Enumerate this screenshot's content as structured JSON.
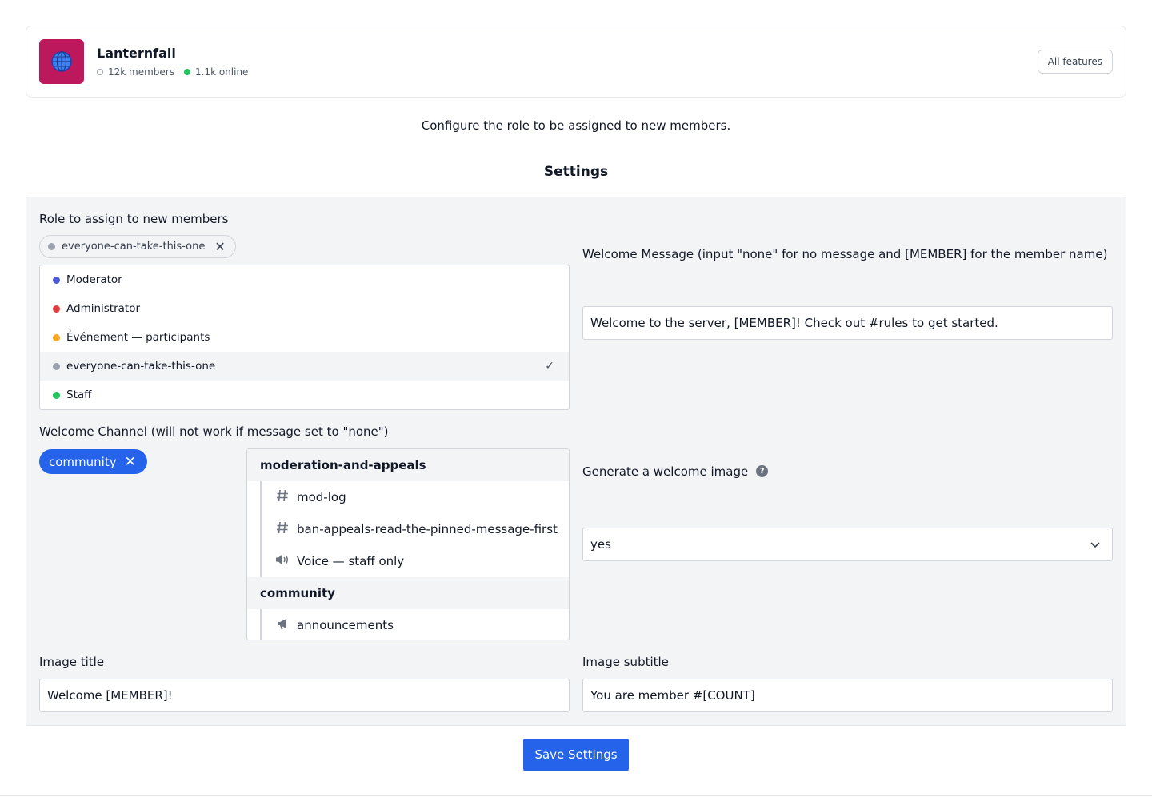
{
  "server": {
    "name": "Lanternfall",
    "members": "12k members",
    "online": "1.1k online",
    "icon": "globe-icon",
    "icon_color": "#be185d",
    "all_features_label": "All features"
  },
  "description": "Configure the role to be assigned to new members.",
  "settings_heading": "Settings",
  "role": {
    "label": "Role to assign to new members",
    "selected": {
      "name": "everyone-can-take-this-one",
      "color": "#9ca3af"
    },
    "options": [
      {
        "name": "Moderator",
        "color": "#4f5bd5",
        "selected": false
      },
      {
        "name": "Administrator",
        "color": "#e03e3e",
        "selected": false
      },
      {
        "name": "Événement — participants",
        "color": "#f5a623",
        "selected": false
      },
      {
        "name": "everyone-can-take-this-one",
        "color": "#9ca3af",
        "selected": true
      },
      {
        "name": "Staff",
        "color": "#22c55e",
        "selected": false
      }
    ],
    "check_glyph": "✓"
  },
  "welcome_message": {
    "label": "Welcome Message (input \"none\" for no message and [MEMBER] for the member name)",
    "value": "Welcome to the server, [MEMBER]! Check out #rules to get started."
  },
  "welcome_channel": {
    "label": "Welcome Channel (will not work if message set to \"none\")",
    "selected": "community",
    "categories": [
      {
        "name": "moderation-and-appeals",
        "channels": [
          {
            "name": "mod-log",
            "type": "text",
            "icon": "hash-icon"
          },
          {
            "name": "ban-appeals-read-the-pinned-message-first",
            "type": "text",
            "icon": "hash-icon"
          },
          {
            "name": "Voice — staff only",
            "type": "voice",
            "icon": "speaker-icon"
          }
        ]
      },
      {
        "name": "community",
        "channels": [
          {
            "name": "announcements",
            "type": "announcement",
            "icon": "megaphone-icon"
          }
        ]
      }
    ]
  },
  "welcome_image": {
    "label": "Generate a welcome image",
    "value": "yes"
  },
  "image_title": {
    "label": "Image title",
    "value": "Welcome [MEMBER]!"
  },
  "image_subtitle": {
    "label": "Image subtitle",
    "value": "You are member #[COUNT]"
  },
  "save_label": "Save Settings",
  "colors": {
    "accent": "#2563eb",
    "panel": "#f3f4f6"
  }
}
